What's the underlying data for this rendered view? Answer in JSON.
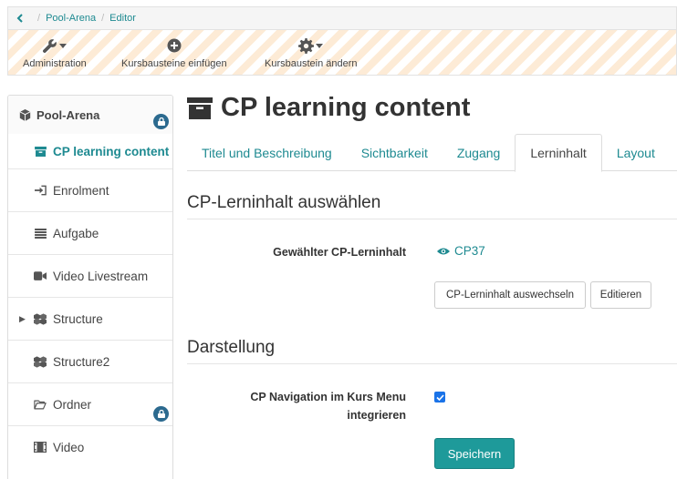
{
  "breadcrumb": {
    "items": [
      "Pool-Arena",
      "Editor"
    ]
  },
  "toolbar": {
    "tools": [
      {
        "label": "Administration",
        "icon": "wrench-icon"
      },
      {
        "label": "Kursbausteine einfügen",
        "icon": "plus-circle-icon"
      },
      {
        "label": "Kursbaustein ändern",
        "icon": "gear-icon"
      }
    ]
  },
  "sidebar": {
    "root": "Pool-Arena",
    "items": [
      {
        "label": "CP learning content",
        "icon": "archive-icon"
      },
      {
        "label": "Enrolment",
        "icon": "sign-in-icon"
      },
      {
        "label": "Aufgabe",
        "icon": "list-icon"
      },
      {
        "label": "Video Livestream",
        "icon": "video-camera-icon"
      },
      {
        "label": "Structure",
        "icon": "cubes-icon"
      },
      {
        "label": "Structure2",
        "icon": "cubes-icon"
      },
      {
        "label": "Ordner",
        "icon": "folder-icon"
      },
      {
        "label": "Video",
        "icon": "film-icon"
      }
    ]
  },
  "page": {
    "title": "CP learning content"
  },
  "tabs": [
    "Titel und Beschreibung",
    "Sichtbarkeit",
    "Zugang",
    "Lerninhalt",
    "Layout"
  ],
  "section1": {
    "heading": "CP-Lerninhalt auswählen",
    "selected_label": "Gewählter CP-Lerninhalt",
    "selected_value": "CP37",
    "btn_switch": "CP-Lerninhalt auswechseln",
    "btn_edit": "Editieren"
  },
  "section2": {
    "heading": "Darstellung",
    "nav_label_line1": "CP Navigation im Kurs Menu",
    "nav_label_line2": "integrieren",
    "nav_checked": true,
    "save": "Speichern"
  },
  "colors": {
    "accent": "#1e8a91",
    "primary_button": "#1e9a9a",
    "lock_badge": "#2c6a8f",
    "toolbar_stripe": "#fdebd6"
  }
}
